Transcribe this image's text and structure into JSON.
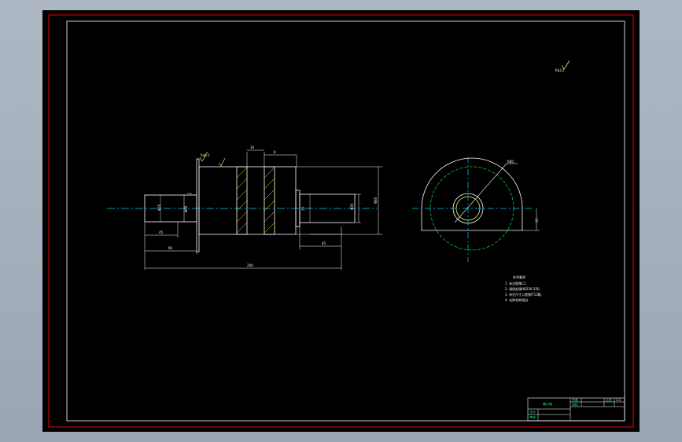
{
  "sheet": {
    "background": "#000000",
    "border_color": "#cc0000",
    "line_color": "#ffffff"
  },
  "colors": {
    "outline": "#ffffff",
    "dimension": "#ffff66",
    "centerline": "#00ccff",
    "hidden_circle": "#00cc33",
    "hatch": "#ffff00"
  },
  "drawing": {
    "roughness_mark": "Ra6.3",
    "roughness_mark_small": "Ra3.2",
    "dimension_labels": {
      "shaft_dia_left": "Φ35",
      "shaft_dia_right": "Φ35",
      "flange_dia": "Φ60",
      "body_dia": "Φ80",
      "key_width": "10",
      "key_width_2": "8",
      "left_step": "45",
      "left_length": "94",
      "right_length": "45",
      "total_length": "240",
      "side_height": "15",
      "radius": "R80"
    }
  },
  "notes": {
    "title": "技术要求",
    "items": [
      "1. 未注倒角C1.",
      "2. 调质处理HB220-250.",
      "3. 未注尺寸公差按IT12级.",
      "4. 去除毛刺锐边."
    ]
  },
  "title_block": {
    "part_name": "偏心轴",
    "scale_label": "比例",
    "scale_value": "1:1",
    "row_labels": [
      "设计",
      "审核"
    ],
    "qty_label": "件数",
    "material_label": "材料"
  }
}
